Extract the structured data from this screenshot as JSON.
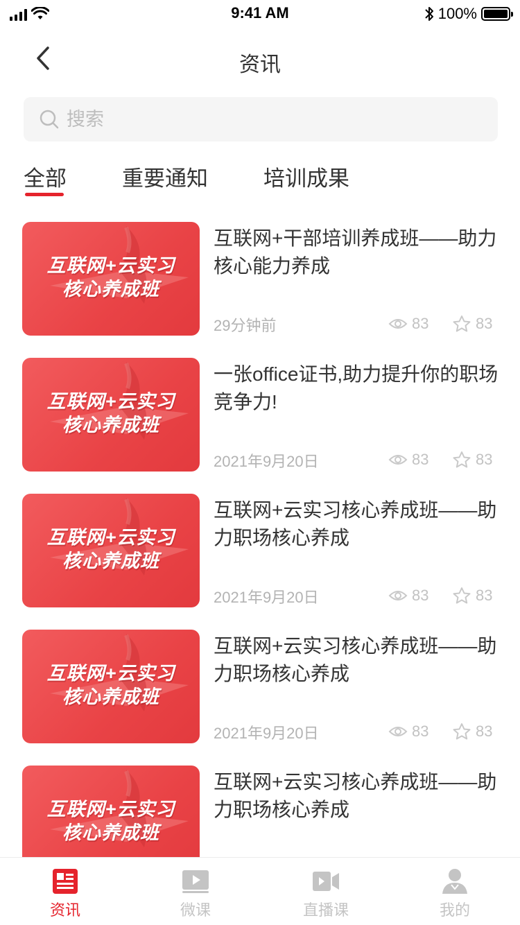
{
  "status_bar": {
    "time": "9:41 AM",
    "battery": "100%"
  },
  "nav": {
    "title": "资讯"
  },
  "search": {
    "placeholder": "搜索"
  },
  "tabs": [
    {
      "label": "全部",
      "active": true
    },
    {
      "label": "重要通知",
      "active": false
    },
    {
      "label": "培训成果",
      "active": false
    }
  ],
  "thumbnail": {
    "line1": "互联网+云实习",
    "line2": "核心养成班"
  },
  "articles": [
    {
      "title": "互联网+干部培训养成班——助力核心能力养成",
      "date": "29分钟前",
      "views": "83",
      "favorites": "83"
    },
    {
      "title": "一张office证书,助力提升你的职场竞争力!",
      "date": "2021年9月20日",
      "views": "83",
      "favorites": "83"
    },
    {
      "title": "互联网+云实习核心养成班——助力职场核心养成",
      "date": "2021年9月20日",
      "views": "83",
      "favorites": "83"
    },
    {
      "title": "互联网+云实习核心养成班——助力职场核心养成",
      "date": "2021年9月20日",
      "views": "83",
      "favorites": "83"
    },
    {
      "title": "互联网+云实习核心养成班——助力职场核心养成"
    }
  ],
  "tabbar": [
    {
      "label": "资讯",
      "icon": "news-icon",
      "active": true
    },
    {
      "label": "微课",
      "icon": "video-play-icon",
      "active": false
    },
    {
      "label": "直播课",
      "icon": "live-camera-icon",
      "active": false
    },
    {
      "label": "我的",
      "icon": "user-icon",
      "active": false
    }
  ],
  "colors": {
    "accent": "#e5232c",
    "thumbnail": "#ec4a4d",
    "muted": "#c4c4c4"
  }
}
